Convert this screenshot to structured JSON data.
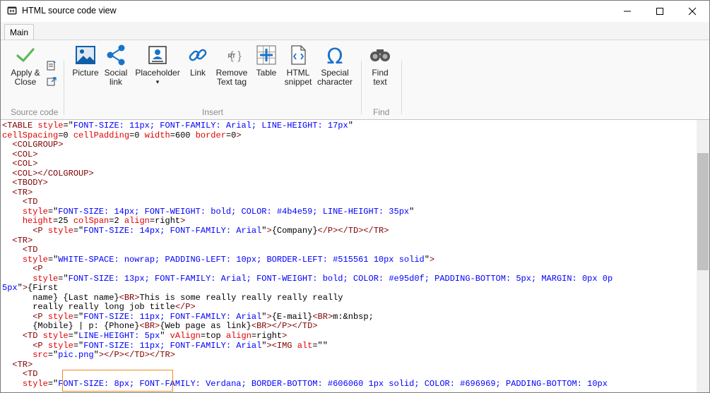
{
  "window": {
    "title": "HTML source code view"
  },
  "window_controls": {
    "minimize": "—",
    "maximize": "☐",
    "close": "✕"
  },
  "ribbon": {
    "tab": "Main",
    "groups": {
      "source_code": {
        "label": "Source code",
        "apply_close": [
          "Apply &",
          "Close"
        ]
      },
      "insert": {
        "label": "Insert",
        "picture": "Picture",
        "social_link": [
          "Social",
          "link"
        ],
        "placeholder": [
          "Placeholder",
          "▾"
        ],
        "link": "Link",
        "remove_text_tag": [
          "Remove",
          "Text tag"
        ],
        "table": "Table",
        "html_snippet": [
          "HTML",
          "snippet"
        ],
        "special_character": [
          "Special",
          "character"
        ]
      },
      "find": {
        "label": "Find",
        "find_text": [
          "Find",
          "text"
        ]
      }
    }
  },
  "editor": {
    "highlighted_text": "WHITE-SPACE: nowrap;",
    "lines": [
      "<TABLE style=\"FONT-SIZE: 11px; FONT-FAMILY: Arial; LINE-HEIGHT: 17px\"",
      "cellSpacing=0 cellPadding=0 width=600 border=0>",
      "  <COLGROUP>",
      "  <COL>",
      "  <COL>",
      "  <COL></COLGROUP>",
      "  <TBODY>",
      "  <TR>",
      "    <TD",
      "    style=\"FONT-SIZE: 14px; FONT-WEIGHT: bold; COLOR: #4b4e59; LINE-HEIGHT: 35px\"",
      "    height=25 colSpan=2 align=right>",
      "      <P style=\"FONT-SIZE: 14px; FONT-FAMILY: Arial\">{Company}</P></TD></TR>",
      "  <TR>",
      "    <TD",
      "    style=\"WHITE-SPACE: nowrap; PADDING-LEFT: 10px; BORDER-LEFT: #515561 10px solid\">",
      "      <P",
      "      style=\"FONT-SIZE: 13px; FONT-FAMILY: Arial; FONT-WEIGHT: bold; COLOR: #e95d0f; PADDING-BOTTOM: 5px; MARGIN: 0px 0px",
      "5px\">{First",
      "      name} {Last name}<BR>This is some really really really really",
      "      really really long job title</P>",
      "      <P style=\"FONT-SIZE: 11px; FONT-FAMILY: Arial\">{E-mail}<BR>m:&nbsp;",
      "      {Mobile} | p: {Phone}<BR>{Web page as link}<BR></P></TD>",
      "    <TD style=\"LINE-HEIGHT: 5px\" vAlign=top align=right>",
      "      <P style=\"FONT-SIZE: 11px; FONT-FAMILY: Arial\"><IMG alt=\"\"",
      "      src=\"pic.png\"></P></TD></TR>",
      "  <TR>",
      "    <TD",
      "    style=\"FONT-SIZE: 8px; FONT-FAMILY: Verdana; BORDER-BOTTOM: #606060 1px solid; COLOR: #696969; PADDING-BOTTOM: 10px;"
    ]
  },
  "colors": {
    "tag": "#800000",
    "attribute": "#e00000",
    "value": "#0000ff",
    "highlight": "#f08a24"
  }
}
